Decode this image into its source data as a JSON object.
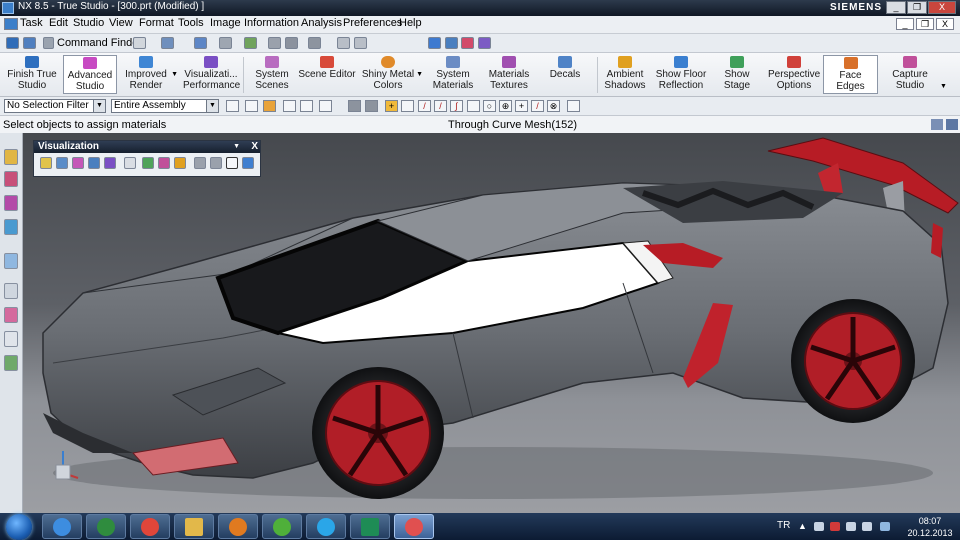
{
  "window": {
    "title": "NX 8.5 - True Studio - [300.prt (Modified) ]",
    "brand": "SIEMENS",
    "minimize_glyph": "_",
    "restore_glyph": "❐",
    "close_glyph": "X"
  },
  "menubar": {
    "items": [
      "Task",
      "Edit",
      "Studio",
      "View",
      "Format",
      "Tools",
      "Image",
      "Information",
      "Analysis",
      "Preferences",
      "Help"
    ]
  },
  "toolbar": {
    "command_finder": "Command Finder"
  },
  "ribbon": {
    "buttons": [
      {
        "label1": "Finish True",
        "label2": "Studio",
        "icon": "finish-flag-icon",
        "color": "#2e6fbf"
      },
      {
        "label1": "Advanced",
        "label2": "Studio",
        "icon": "advanced-studio-icon",
        "color": "#c74ac2"
      },
      {
        "label1": "Improved",
        "label2": "Render",
        "icon": "improved-render-icon",
        "color": "#3f86d4"
      },
      {
        "label1": "Visualizati...",
        "label2": "Performance",
        "icon": "performance-icon",
        "color": "#7a4fc4"
      },
      {
        "label1": "System",
        "label2": "Scenes",
        "icon": "system-scenes-icon",
        "color": "#b86cc0"
      },
      {
        "label1": "Scene Editor",
        "label2": "",
        "icon": "scene-editor-icon",
        "color": "#d84a3a"
      },
      {
        "label1": "Shiny Metal",
        "label2": "Colors",
        "icon": "shiny-metal-icon",
        "color": "#e08a2a"
      },
      {
        "label1": "System",
        "label2": "Materials",
        "icon": "system-materials-icon",
        "color": "#6b8cc4"
      },
      {
        "label1": "Materials",
        "label2": "Textures",
        "icon": "materials-textures-icon",
        "color": "#a04fb0"
      },
      {
        "label1": "Decals",
        "label2": "",
        "icon": "decals-icon",
        "color": "#4f83c7"
      },
      {
        "label1": "Ambient",
        "label2": "Shadows",
        "icon": "ambient-shadows-icon",
        "color": "#e0a020"
      },
      {
        "label1": "Show Floor",
        "label2": "Reflection",
        "icon": "floor-reflection-icon",
        "color": "#3a7fd0"
      },
      {
        "label1": "Show Stage",
        "label2": "",
        "icon": "show-stage-icon",
        "color": "#3fa05a"
      },
      {
        "label1": "Perspective",
        "label2": "Options",
        "icon": "perspective-icon",
        "color": "#d0403a"
      },
      {
        "label1": "Face Edges",
        "label2": "",
        "icon": "face-edges-icon",
        "color": "#d8702a"
      },
      {
        "label1": "Capture",
        "label2": "Studio",
        "icon": "capture-studio-icon",
        "color": "#c0509a"
      }
    ]
  },
  "selection": {
    "filter": "No Selection Filter",
    "scope": "Entire Assembly"
  },
  "status": {
    "cue": "Select objects to assign materials",
    "selection": "Through Curve Mesh(152)"
  },
  "vis_panel": {
    "title": "Visualization",
    "close_glyph": "X"
  },
  "taskbar": {
    "language": "TR",
    "time": "08:07",
    "date": "20.12.2013",
    "apps": [
      {
        "icon": "internet-explorer-icon",
        "color": "#3d8de0"
      },
      {
        "icon": "media-center-icon",
        "color": "#2f8c3e"
      },
      {
        "icon": "chrome-icon",
        "color": "#e0463a"
      },
      {
        "icon": "explorer-folder-icon",
        "color": "#e2b84a"
      },
      {
        "icon": "media-player-icon",
        "color": "#e07a20"
      },
      {
        "icon": "utorrent-icon",
        "color": "#4fb03a"
      },
      {
        "icon": "skype-icon",
        "color": "#2aa6e8"
      },
      {
        "icon": "spreadsheet-icon",
        "color": "#1e8c55"
      },
      {
        "icon": "nx-icon",
        "color": "#e05050"
      }
    ]
  }
}
